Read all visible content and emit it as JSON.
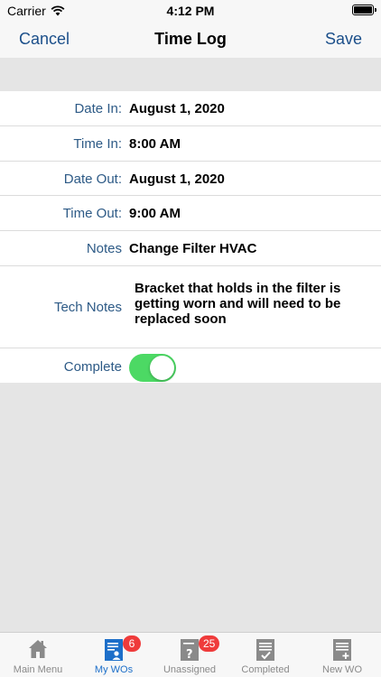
{
  "status_bar": {
    "carrier": "Carrier",
    "time": "4:12 PM",
    "icons": [
      "wifi-icon",
      "battery-icon"
    ]
  },
  "nav": {
    "cancel_label": "Cancel",
    "title": "Time Log",
    "save_label": "Save",
    "accent_color": "#1b4f8a"
  },
  "form": {
    "date_in": {
      "label": "Date In:",
      "value": "August 1, 2020"
    },
    "time_in": {
      "label": "Time In:",
      "value": "8:00 AM"
    },
    "date_out": {
      "label": "Date Out:",
      "value": "August 1, 2020"
    },
    "time_out": {
      "label": "Time Out:",
      "value": "9:00 AM"
    },
    "notes": {
      "label": "Notes",
      "value": "Change Filter HVAC"
    },
    "tech_notes": {
      "label": "Tech Notes",
      "value": "Bracket that holds in the filter is getting worn and will need to be replaced soon"
    },
    "complete": {
      "label": "Complete",
      "checked": true,
      "on_color": "#4cd964"
    }
  },
  "tab_bar": {
    "tabs": [
      {
        "label": "Main Menu",
        "icon": "house-icon",
        "active": false,
        "badge": null
      },
      {
        "label": "My WOs",
        "icon": "my-wos-icon",
        "active": true,
        "badge": "6"
      },
      {
        "label": "Unassigned",
        "icon": "unassigned-icon",
        "active": false,
        "badge": "25"
      },
      {
        "label": "Completed",
        "icon": "completed-icon",
        "active": false,
        "badge": null
      },
      {
        "label": "New WO",
        "icon": "new-wo-icon",
        "active": false,
        "badge": null
      }
    ],
    "active_color": "#1d6fc9",
    "badge_color": "#ef3b3b"
  }
}
